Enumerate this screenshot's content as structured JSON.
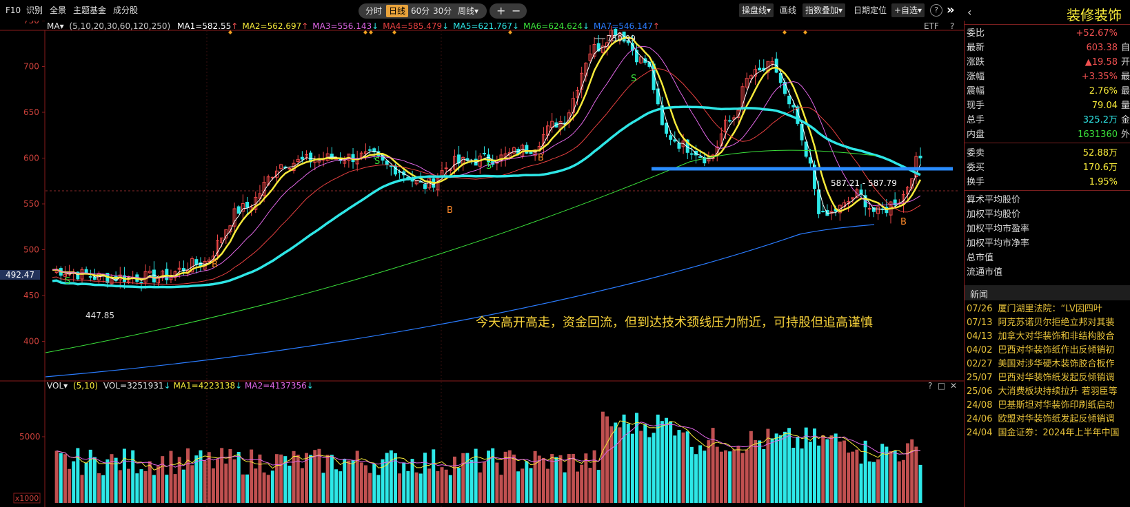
{
  "toolbar": {
    "left_items": [
      "F10",
      "识别",
      "全景",
      "主题基金",
      "成分股"
    ],
    "periods": [
      "分时",
      "日线",
      "60分",
      "30分",
      "周线▾"
    ],
    "active_period": "日线",
    "zoom_in": "+",
    "zoom_out": "−",
    "right_items": [
      "操盘线▾",
      "画线",
      "指数叠加▾",
      "日期定位",
      "+自选▾"
    ],
    "help_icon": "question-icon",
    "collapse_icon": "double-chevron-right-icon"
  },
  "ma_legend": {
    "label": "MA▾",
    "params": "(5,10,20,30,60,120,250)",
    "items": [
      {
        "text": "MA1=582.55",
        "arrow": "↑",
        "color": "#ffffff"
      },
      {
        "text": "MA2=562.697",
        "arrow": "↑",
        "color": "#f7ea3a"
      },
      {
        "text": "MA3=556.143",
        "arrow": "↓",
        "color": "#e066e6"
      },
      {
        "text": "MA4=585.479",
        "arrow": "↓",
        "color": "#e84040"
      },
      {
        "text": "MA5=621.767",
        "arrow": "↓",
        "color": "#2ee6e6"
      },
      {
        "text": "MA6=624.624",
        "arrow": "↓",
        "color": "#3be23b"
      },
      {
        "text": "MA7=546.147",
        "arrow": "↑",
        "color": "#2a7cff"
      }
    ],
    "etf": "ETF",
    "help": "?"
  },
  "price_axis": {
    "ticks": [
      "750",
      "700",
      "650",
      "600",
      "550",
      "500",
      "450",
      "400"
    ],
    "current": "492.47"
  },
  "annotations": {
    "high": "750.99",
    "low": "447.85",
    "range": "587.21 - 587.79",
    "comment": "今天高开高走，资金回流，但到达技术颈线压力附近，可持股但追高谨慎",
    "signals": [
      "S",
      "S",
      "S",
      "S",
      "B",
      "B",
      "B",
      "B"
    ]
  },
  "vol_legend": {
    "label": "VOL▾",
    "params": "(5,10)",
    "vol": "VOL=3251931",
    "vol_arrow": "↓",
    "ma1": "MA1=4223138",
    "ma1_arrow": "↓",
    "ma2": "MA2=4137356",
    "ma2_arrow": "↓",
    "axis_5000": "5000",
    "unit": "x1000",
    "icons": [
      "?",
      "□",
      "✕"
    ]
  },
  "stock": {
    "name": "装修装饰",
    "rows": [
      {
        "label": "委比",
        "value": "+52.67%",
        "unit": "",
        "color": "#f05050"
      },
      {
        "label": "最新",
        "value": "603.38",
        "unit": "自",
        "color": "#f05050"
      },
      {
        "label": "涨跌",
        "value": "▲19.58",
        "unit": "开",
        "color": "#f05050"
      },
      {
        "label": "涨幅",
        "value": "+3.35%",
        "unit": "最",
        "color": "#f05050"
      },
      {
        "label": "震幅",
        "value": "2.76%",
        "unit": "最",
        "color": "#f7ea3a"
      },
      {
        "label": "现手",
        "value": "79.04",
        "unit": "量",
        "color": "#f7ea3a"
      },
      {
        "label": "总手",
        "value": "325.2万",
        "unit": "金",
        "color": "#2ee6e6"
      },
      {
        "label": "内盘",
        "value": "1631360",
        "unit": "外",
        "color": "#3be23b"
      },
      {
        "label": "委卖",
        "value": "52.88万",
        "unit": "",
        "color": "#f7ea3a"
      },
      {
        "label": "委买",
        "value": "170.6万",
        "unit": "",
        "color": "#f7ea3a"
      },
      {
        "label": "换手",
        "value": "1.95%",
        "unit": "",
        "color": "#f7ea3a"
      }
    ],
    "metrics": [
      "算术平均股价",
      "加权平均股价",
      "加权平均市盈率",
      "加权平均市净率",
      "总市值",
      "流通市值"
    ],
    "news_title": "新闻",
    "news": [
      {
        "date": "07/26",
        "title": "厦门湖里法院：“LV因四叶"
      },
      {
        "date": "07/13",
        "title": "阿克苏诺贝尔拒绝立邦对其装"
      },
      {
        "date": "04/13",
        "title": "加拿大对华装饰和非结构胶合"
      },
      {
        "date": "04/02",
        "title": "巴西对华装饰纸作出反倾销初"
      },
      {
        "date": "02/27",
        "title": "美国对涉华硬木装饰胶合板作"
      },
      {
        "date": "25/07",
        "title": "巴西对华装饰纸发起反倾销调"
      },
      {
        "date": "25/06",
        "title": "大消费板块持续拉升 若羽臣等"
      },
      {
        "date": "24/08",
        "title": "巴基斯坦对华装饰印刷纸启动"
      },
      {
        "date": "24/06",
        "title": "欧盟对华装饰纸发起反倾销调"
      },
      {
        "date": "24/04",
        "title": "国金证券：2024年上半年中国"
      }
    ]
  },
  "colors": {
    "up": "#f04848",
    "down": "#2de8e8",
    "ma5": "#f7ea3a",
    "ma60": "#2ee6e6",
    "ma120": "#3be23b",
    "ma250": "#2a7cff",
    "neckline": "#2a8cff",
    "comment": "#f7d23a"
  }
}
